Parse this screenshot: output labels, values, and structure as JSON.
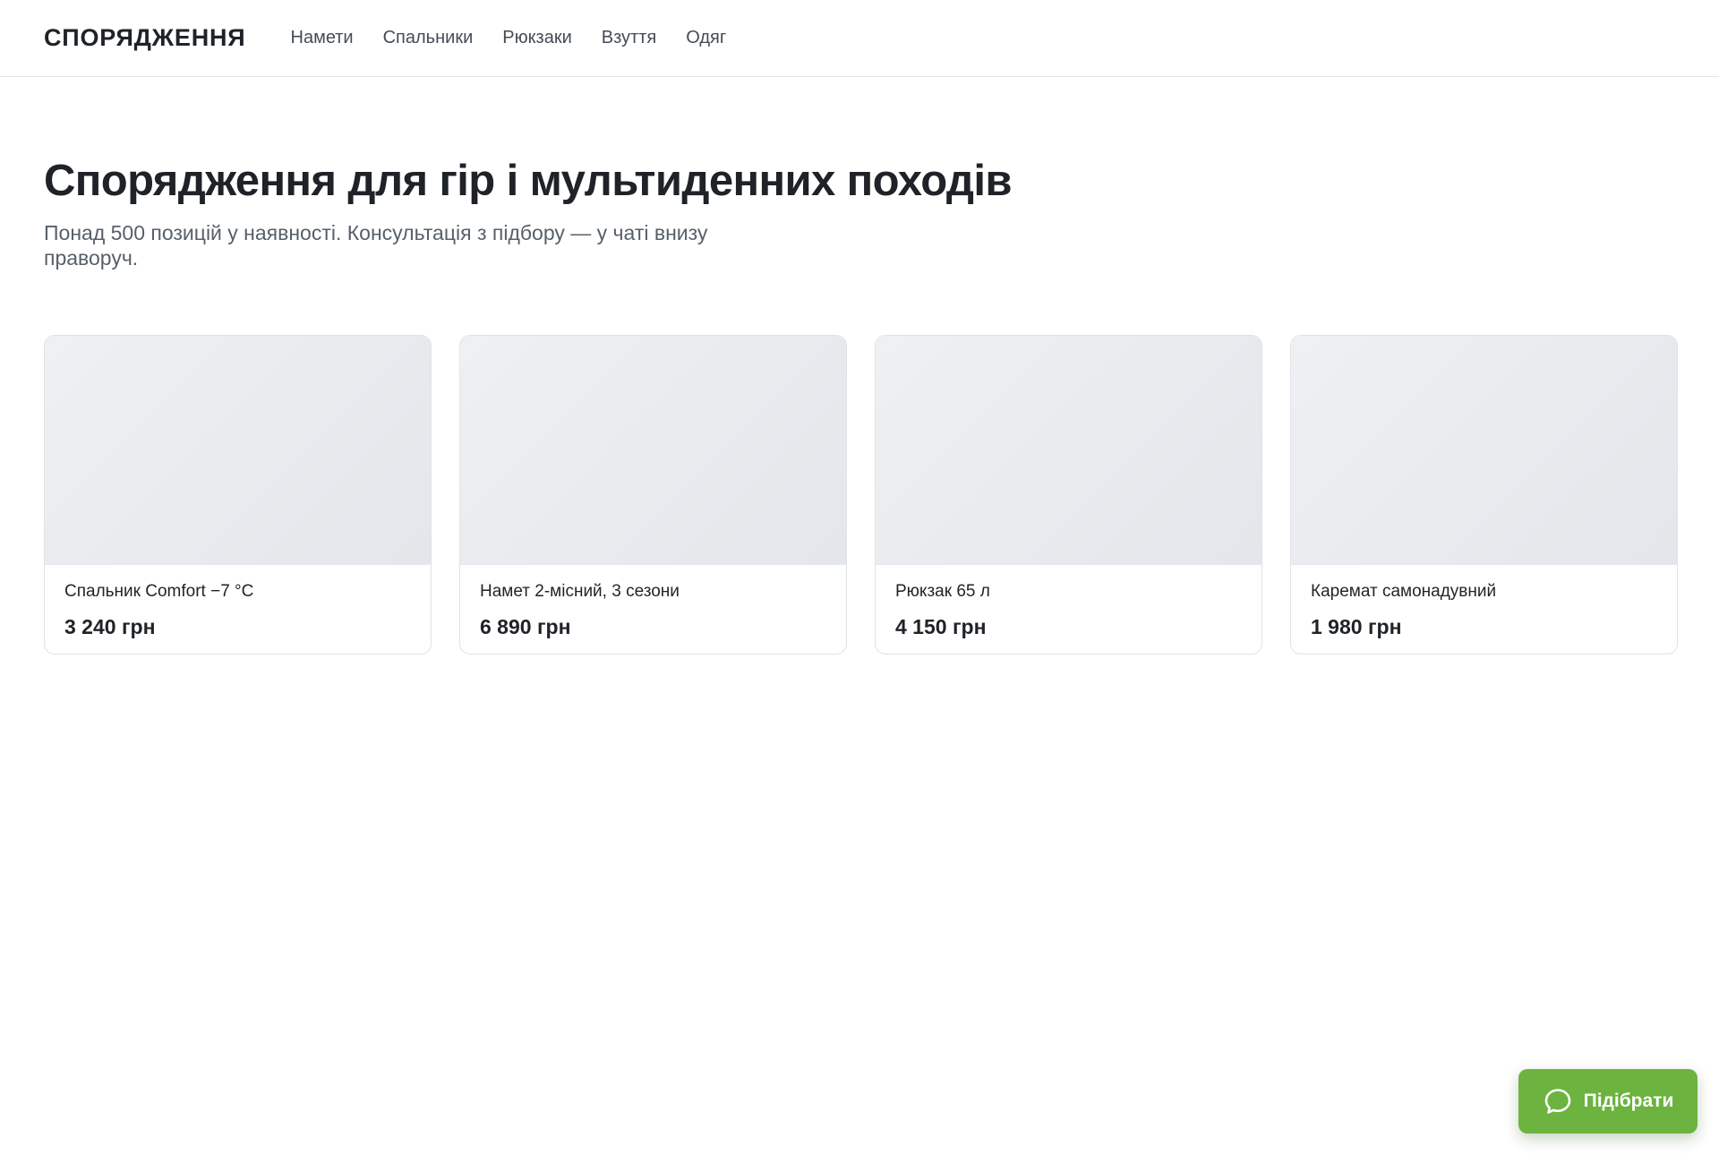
{
  "header": {
    "brand": "СПОРЯДЖЕННЯ",
    "nav": [
      {
        "label": "Намети"
      },
      {
        "label": "Спальники"
      },
      {
        "label": "Рюкзаки"
      },
      {
        "label": "Взуття"
      },
      {
        "label": "Одяг"
      }
    ]
  },
  "hero": {
    "title": "Спорядження для гір і мультиденних походів",
    "subtitle": "Понад 500 позицій у наявності. Консультація з підбору — у чаті внизу праворуч."
  },
  "products": [
    {
      "name": "Спальник Comfort −7 °C",
      "price": "3 240 грн"
    },
    {
      "name": "Намет 2-місний, 3 сезони",
      "price": "6 890 грн"
    },
    {
      "name": "Рюкзак 65 л",
      "price": "4 150 грн"
    },
    {
      "name": "Каремат самонадувний",
      "price": "1 980 грн"
    }
  ],
  "chat_button": {
    "label": "Підібрати",
    "icon": "chat-bubble-icon",
    "color": "#6cb33f"
  }
}
